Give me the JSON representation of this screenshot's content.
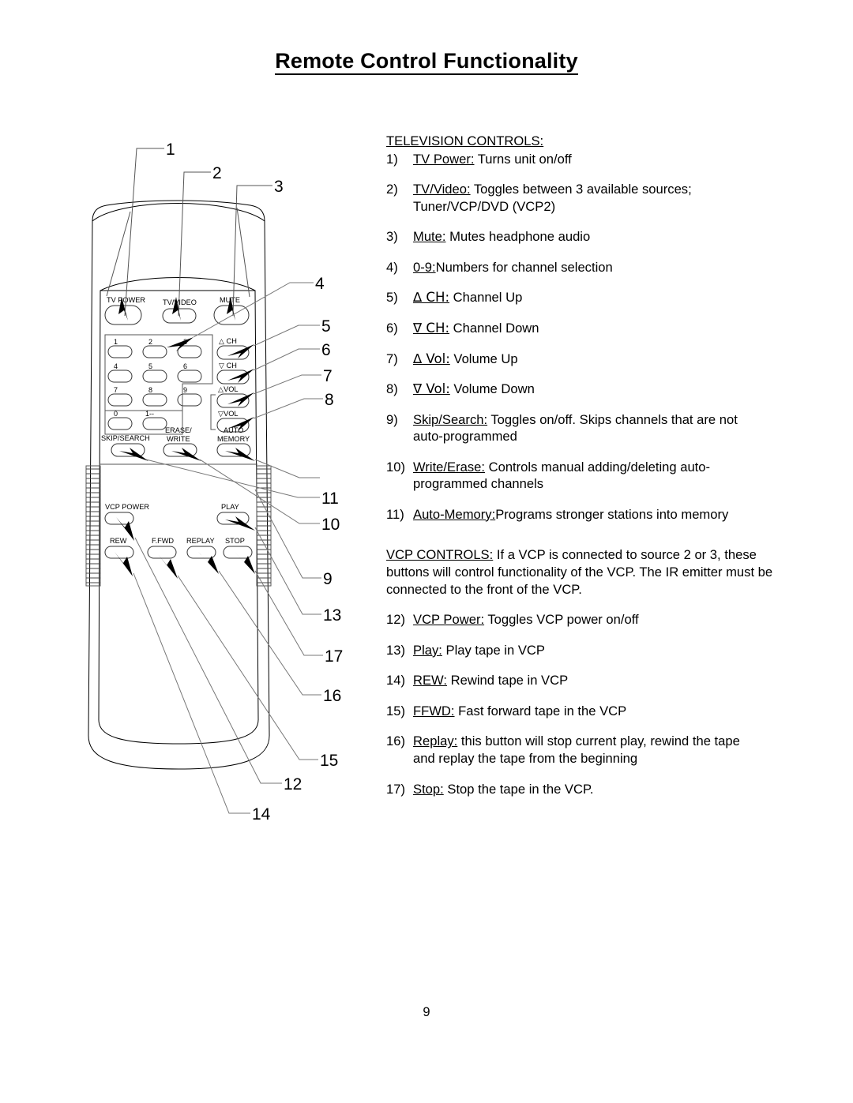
{
  "document": {
    "title": "Remote Control Functionality",
    "page_number": "9"
  },
  "television_section": {
    "heading": "TELEVISION CONTROLS:",
    "items": [
      {
        "num": "1)",
        "term": "TV Power:",
        "desc": "Turns unit on/off"
      },
      {
        "num": "2)",
        "term": "TV/Video:",
        "desc": "Toggles between 3 available sources;",
        "desc2": "Tuner/VCP/DVD (VCP2)"
      },
      {
        "num": "3)",
        "term": "Mute:",
        "desc": "Mutes headphone audio"
      },
      {
        "num": "4)",
        "term": "0-9:",
        "desc": "Numbers for channel selection"
      },
      {
        "num": "5)",
        "term": "∆ CH:",
        "desc": "Channel Up"
      },
      {
        "num": "6)",
        "term": "∇ CH:",
        "desc": "Channel Down"
      },
      {
        "num": "7)",
        "term": "∆ Vol:",
        "desc": "Volume Up"
      },
      {
        "num": "8)",
        "term": "∇ Vol:",
        "desc": "Volume Down"
      },
      {
        "num": "9)",
        "term": "Skip/Search:",
        "desc": "Toggles on/off.  Skips channels that are not",
        "desc2": "auto-programmed"
      },
      {
        "num": "10)",
        "term": "Write/Erase:",
        "desc": "Controls manual adding/deleting auto-",
        "desc2": "programmed channels"
      },
      {
        "num": "11)",
        "term": "Auto-Memory:",
        "desc": "Programs stronger stations into memory"
      }
    ]
  },
  "vcp_section": {
    "heading": "VCP CONTROLS:",
    "intro": " If a VCP is connected to source 2 or 3, these buttons will control functionality of the VCP.  The IR emitter must be connected to the front of the VCP.",
    "items": [
      {
        "num": "12)",
        "term": "VCP Power:",
        "desc": "Toggles VCP power on/off"
      },
      {
        "num": "13)",
        "term": "Play:",
        "desc": "Play tape in VCP"
      },
      {
        "num": "14)",
        "term": "REW:",
        "desc": "Rewind tape in VCP"
      },
      {
        "num": "15)",
        "term": "FFWD:",
        "desc": "Fast forward tape in the VCP"
      },
      {
        "num": "16)",
        "term": "Replay:",
        "desc": "this button will stop current play, rewind the tape",
        "desc2": "and replay the tape from the beginning"
      },
      {
        "num": "17)",
        "term": "Stop:",
        "desc": "Stop the tape in the VCP."
      }
    ]
  },
  "remote_diagram": {
    "tv_buttons": [
      {
        "id": "tv-power",
        "label": "TV  POWER"
      },
      {
        "id": "tv-video",
        "label": "TV/VIDEO"
      },
      {
        "id": "mute",
        "label": "MUTE"
      }
    ],
    "keypad_buttons": [
      {
        "id": "num-1",
        "label": "1"
      },
      {
        "id": "num-2",
        "label": "2"
      },
      {
        "id": "num-3",
        "label": "3"
      },
      {
        "id": "num-4",
        "label": "4"
      },
      {
        "id": "num-5",
        "label": "5"
      },
      {
        "id": "num-6",
        "label": "6"
      },
      {
        "id": "num-7",
        "label": "7"
      },
      {
        "id": "num-8",
        "label": "8"
      },
      {
        "id": "num-9",
        "label": "9"
      },
      {
        "id": "num-0",
        "label": "0"
      },
      {
        "id": "num-1dashdash",
        "label": "1--"
      }
    ],
    "side_buttons": [
      {
        "id": "ch-up",
        "label": "△ CH"
      },
      {
        "id": "ch-down",
        "label": "▽ CH"
      },
      {
        "id": "vol-up",
        "label": "△VOL"
      },
      {
        "id": "vol-down",
        "label": "▽VOL"
      }
    ],
    "function_buttons": [
      {
        "id": "skip-search",
        "label_line1": "SKIP/SEARCH",
        "label_line2": ""
      },
      {
        "id": "erase-write",
        "label_line1": "ERASE/",
        "label_line2": "WRITE"
      },
      {
        "id": "auto-memory",
        "label_line1": "AUTO",
        "label_line2": "MEMORY"
      }
    ],
    "vcp_buttons": [
      {
        "id": "vcp-power",
        "label": "VCP  POWER"
      },
      {
        "id": "play",
        "label": "PLAY"
      },
      {
        "id": "rew",
        "label": "REW"
      },
      {
        "id": "ffwd",
        "label": "F.FWD"
      },
      {
        "id": "replay",
        "label": "REPLAY"
      },
      {
        "id": "stop",
        "label": "STOP"
      }
    ],
    "callouts": [
      {
        "id": "callout-1",
        "label": "1"
      },
      {
        "id": "callout-2",
        "label": "2"
      },
      {
        "id": "callout-3",
        "label": "3"
      },
      {
        "id": "callout-4",
        "label": "4"
      },
      {
        "id": "callout-5",
        "label": "5"
      },
      {
        "id": "callout-6",
        "label": "6"
      },
      {
        "id": "callout-7",
        "label": "7"
      },
      {
        "id": "callout-8",
        "label": "8"
      },
      {
        "id": "callout-11",
        "label": "11"
      },
      {
        "id": "callout-10",
        "label": "10"
      },
      {
        "id": "callout-9",
        "label": "9"
      },
      {
        "id": "callout-13",
        "label": "13"
      },
      {
        "id": "callout-17",
        "label": "17"
      },
      {
        "id": "callout-16",
        "label": "16"
      },
      {
        "id": "callout-15",
        "label": "15"
      },
      {
        "id": "callout-12",
        "label": "12"
      },
      {
        "id": "callout-14",
        "label": "14"
      }
    ]
  }
}
